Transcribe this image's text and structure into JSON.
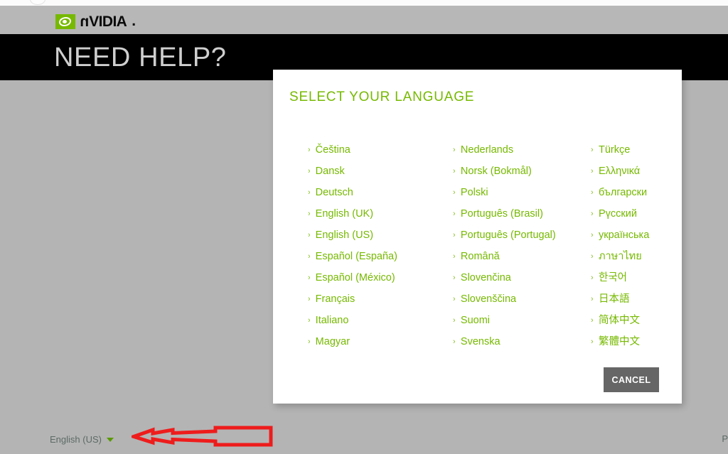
{
  "browser": {
    "top_strip": ""
  },
  "brand": {
    "name": "NVIDIA",
    "wordmark_prefix": "n",
    "wordmark_rest": "VIDIA",
    "dot": ".",
    "green": "#76b900"
  },
  "hero": {
    "title": "NEED HELP?"
  },
  "dialog": {
    "title": "SELECT YOUR LANGUAGE",
    "cancel_label": "CANCEL",
    "chevron": "›",
    "columns": [
      {
        "items": [
          "Čeština",
          "Dansk",
          "Deutsch",
          "English (UK)",
          "English (US)",
          "Español (España)",
          "Español (México)",
          "Français",
          "Italiano",
          "Magyar"
        ]
      },
      {
        "items": [
          "Nederlands",
          "Norsk (Bokmål)",
          "Polski",
          "Português (Brasil)",
          "Português (Portugal)",
          "Română",
          "Slovenčina",
          "Slovenščina",
          "Suomi",
          "Svenska"
        ]
      },
      {
        "items": [
          "Türkçe",
          "Ελληνικά",
          "български",
          "Рүсский",
          "українська",
          "ภาษาไทย",
          "한국어",
          "日本語",
          "简体中文",
          "繁體中文"
        ]
      }
    ]
  },
  "footer": {
    "current_language": "English (US)",
    "right_text_partial": "P"
  },
  "annotation": {
    "arrow_color": "#ee1c1c",
    "direction": "left"
  }
}
